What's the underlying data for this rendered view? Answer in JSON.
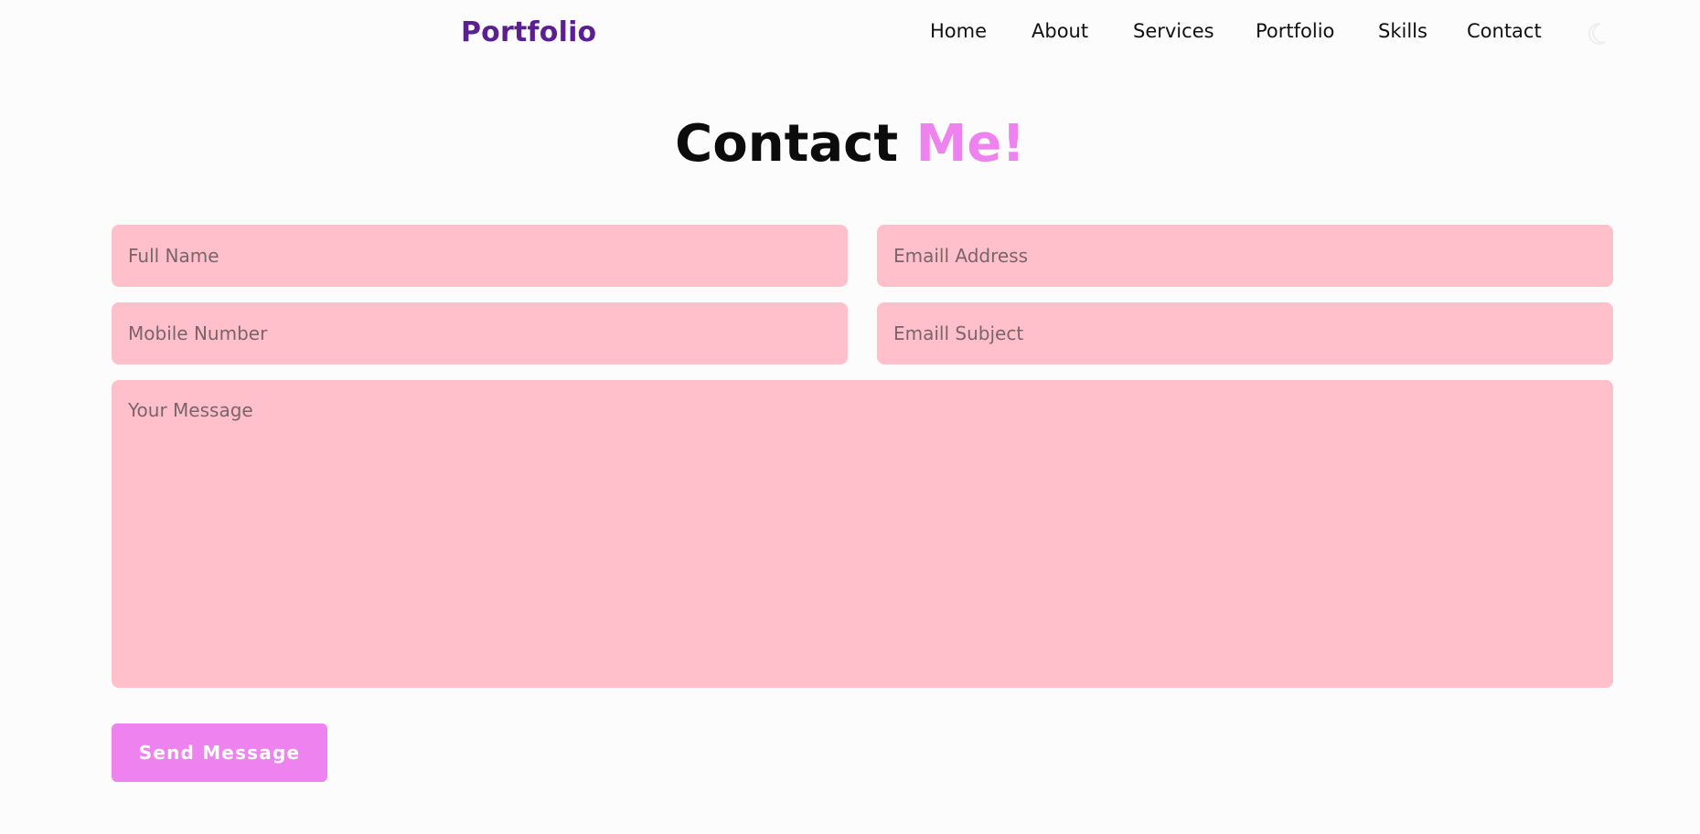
{
  "header": {
    "logo": "Portfolio",
    "nav": [
      "Home",
      "About",
      "Services",
      "Portfolio",
      "Skills",
      "Contact"
    ],
    "theme_toggle_icon": "moon-icon"
  },
  "contact": {
    "title_part1": "Contact",
    "title_part2": "Me!",
    "fields": {
      "full_name_placeholder": "Full Name",
      "email_placeholder": "Emaill Address",
      "mobile_placeholder": "Mobile Number",
      "subject_placeholder": "Emaill Subject",
      "message_placeholder": "Your Message"
    },
    "send_label": "Send Message"
  },
  "colors": {
    "brand": "#5b1f91",
    "accent": "#ee82ee",
    "field_bg": "#ffc0cb"
  }
}
